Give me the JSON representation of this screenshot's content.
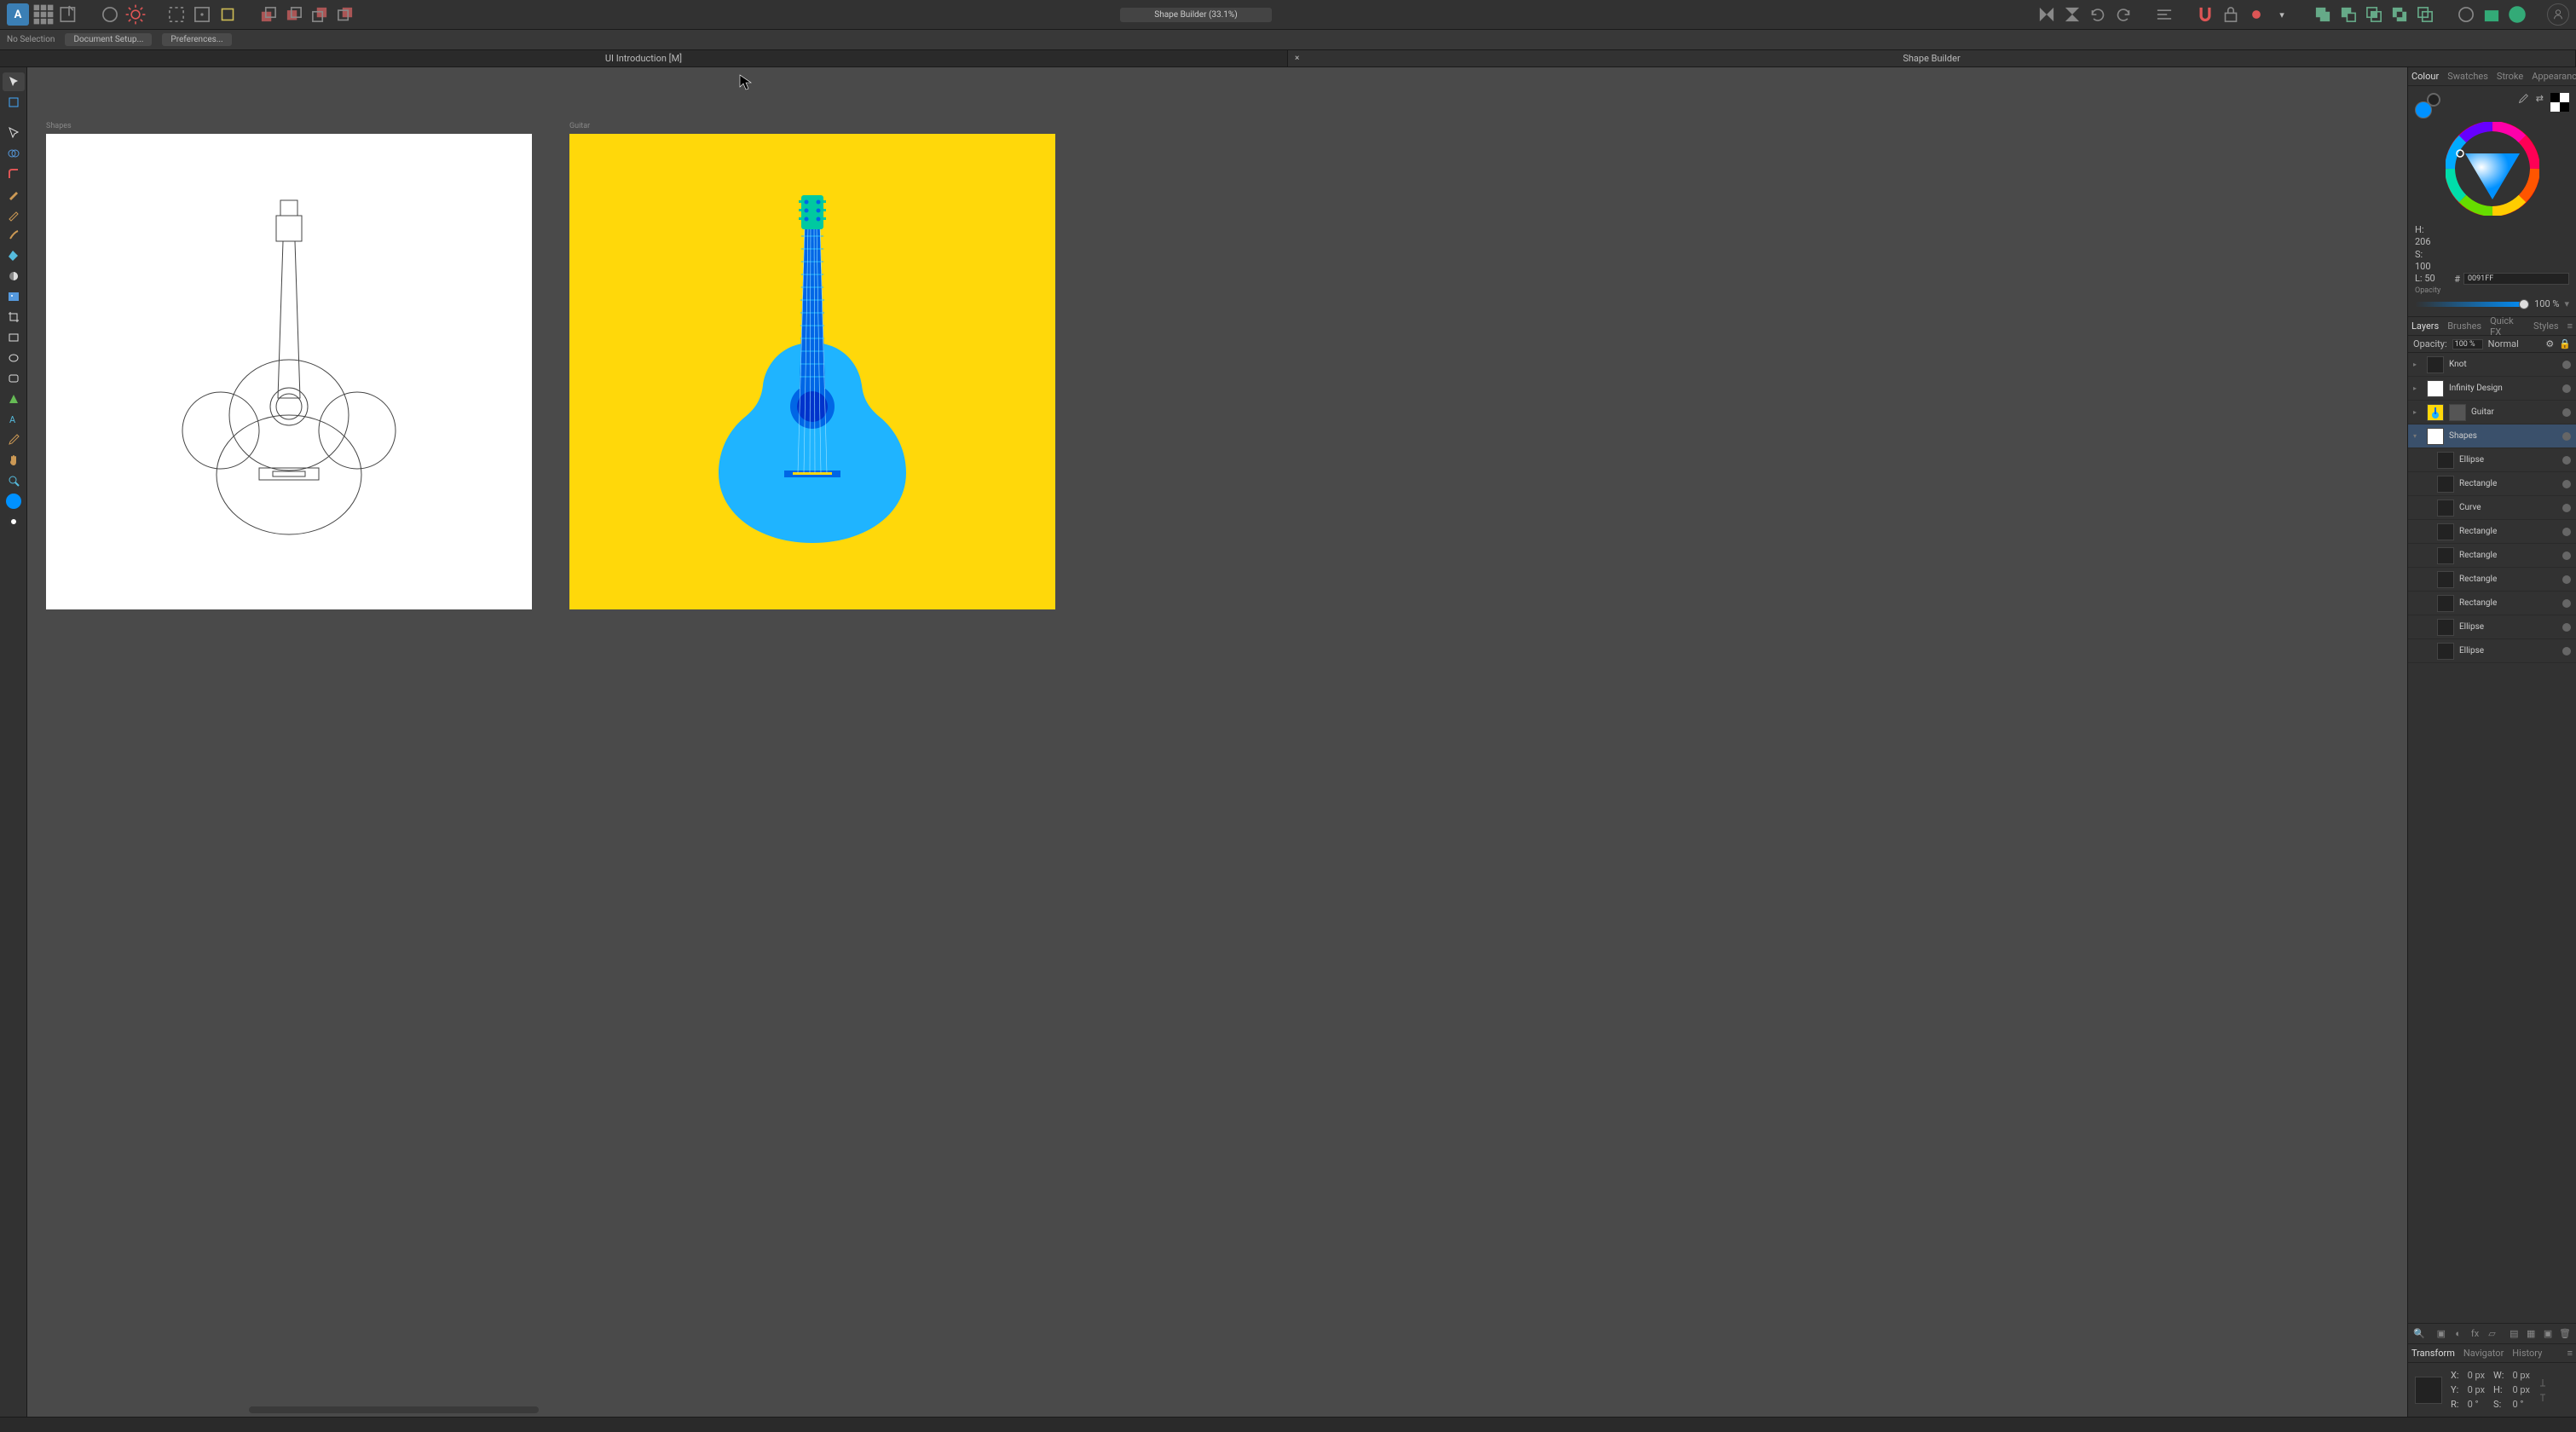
{
  "topbar": {
    "title_pill": "Shape Builder (33.1%)"
  },
  "context_bar": {
    "selection_label": "No Selection",
    "btn_doc_setup": "Document Setup...",
    "btn_prefs": "Preferences..."
  },
  "doc_tabs": [
    {
      "label": "UI Introduction [M]",
      "active": false
    },
    {
      "label": "Shape Builder",
      "active": true
    }
  ],
  "artboards": {
    "shapes_label": "Shapes",
    "guitar_label": "Guitar"
  },
  "panel_tabs_upper": [
    "Colour",
    "Swatches",
    "Stroke",
    "Appearance"
  ],
  "panel_tabs_upper_active": 0,
  "colour": {
    "h": "H: 206",
    "s": "S: 100",
    "l": "L: 50",
    "opacity_label": "Opacity",
    "hex_prefix": "#",
    "hex": "0091FF",
    "opacity_value": "100 %"
  },
  "panel_tabs_mid": [
    "Layers",
    "Brushes",
    "Quick FX",
    "Styles"
  ],
  "panel_tabs_mid_active": 0,
  "layers_header": {
    "opacity_label": "Opacity:",
    "opacity_value": "100 %",
    "blend": "Normal"
  },
  "layers": [
    {
      "name": "Knot",
      "thumb": "dark",
      "selected": false
    },
    {
      "name": "Infinity Design",
      "thumb": "white",
      "selected": false
    },
    {
      "name": "Guitar",
      "thumb": "yel",
      "selected": false,
      "masked": true
    },
    {
      "name": "Shapes",
      "thumb": "white",
      "selected": true,
      "expanded": true
    },
    {
      "name": "Ellipse",
      "thumb": "dark",
      "child": true
    },
    {
      "name": "Rectangle",
      "thumb": "dark",
      "child": true
    },
    {
      "name": "Curve",
      "thumb": "dark",
      "child": true
    },
    {
      "name": "Rectangle",
      "thumb": "dark",
      "child": true
    },
    {
      "name": "Rectangle",
      "thumb": "dark",
      "child": true
    },
    {
      "name": "Rectangle",
      "thumb": "dark",
      "child": true
    },
    {
      "name": "Rectangle",
      "thumb": "dark",
      "child": true
    },
    {
      "name": "Ellipse",
      "thumb": "dark",
      "child": true
    },
    {
      "name": "Ellipse",
      "thumb": "dark",
      "child": true
    }
  ],
  "panel_tabs_lower": [
    "Transform",
    "Navigator",
    "History"
  ],
  "panel_tabs_lower_active": 0,
  "transform": {
    "x_label": "X:",
    "x": "0 px",
    "y_label": "Y:",
    "y": "0 px",
    "w_label": "W:",
    "w": "0 px",
    "h_label": "H:",
    "h": "0 px",
    "r_label": "R:",
    "r": "0 °",
    "s_label": "S:",
    "s": "0 °"
  },
  "colors": {
    "accent": "#0091ff",
    "guitar_bg": "#ffd80a",
    "guitar_body": "#1fb4ff",
    "guitar_neck": "#0066e6",
    "guitar_head": "#00c9a0",
    "guitar_hole": "#0033cc"
  }
}
